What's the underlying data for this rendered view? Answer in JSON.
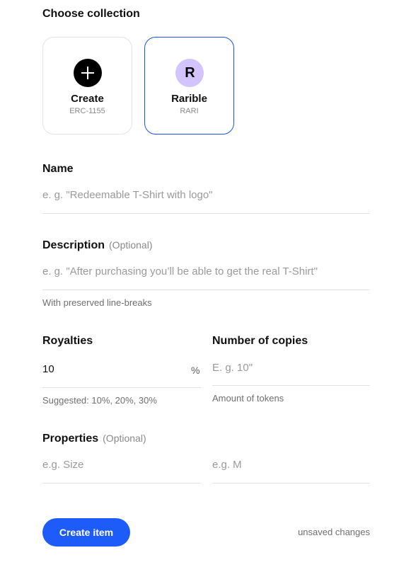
{
  "collection": {
    "title": "Choose collection",
    "cards": [
      {
        "title": "Create",
        "subtitle": "ERC-1155",
        "icon": "plus-icon",
        "selected": false
      },
      {
        "title": "Rarible",
        "subtitle": "RARI",
        "icon": "rarible-logo-icon",
        "logo_text": "R",
        "selected": true
      }
    ]
  },
  "name": {
    "label": "Name",
    "placeholder": "e. g. \"Redeemable T-Shirt with logo\""
  },
  "description": {
    "label": "Description",
    "optional": "(Optional)",
    "placeholder": "e. g. \"After purchasing you’ll be able to get the real T-Shirt\"",
    "hint": "With preserved line-breaks"
  },
  "royalties": {
    "label": "Royalties",
    "value": "10",
    "unit": "%",
    "hint": "Suggested: 10%, 20%, 30%"
  },
  "copies": {
    "label": "Number of copies",
    "placeholder": "E. g. 10\"",
    "hint": "Amount of tokens"
  },
  "properties": {
    "label": "Properties",
    "optional": "(Optional)",
    "key_placeholder": "e.g. Size",
    "value_placeholder": "e.g. M"
  },
  "footer": {
    "create_label": "Create item",
    "status": "unsaved changes"
  },
  "colors": {
    "accent": "#1e5cfa",
    "selected_border": "#1554f0",
    "rarible_badge": "#d3c4ff"
  }
}
